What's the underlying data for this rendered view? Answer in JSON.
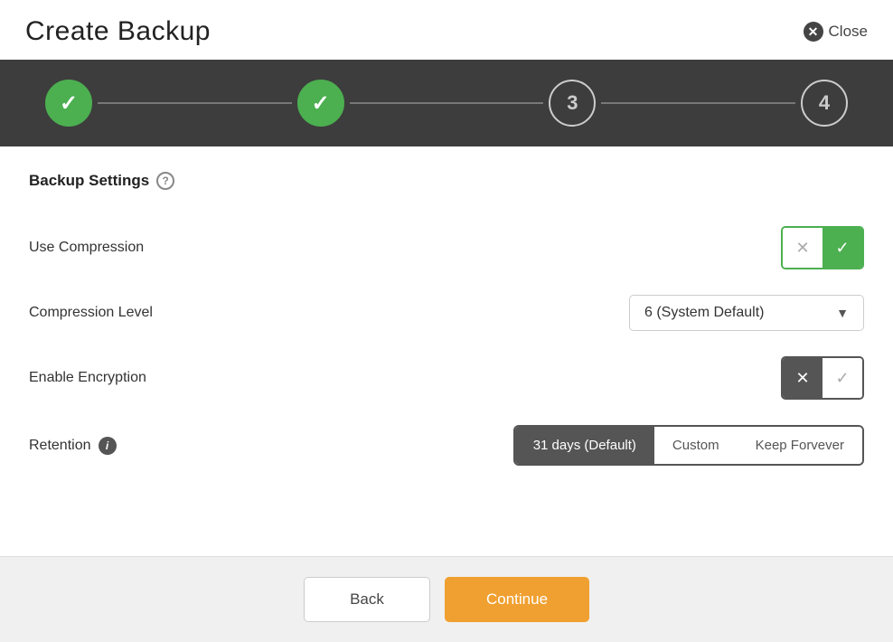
{
  "header": {
    "title": "Create Backup",
    "close_label": "Close"
  },
  "stepper": {
    "steps": [
      {
        "id": 1,
        "label": "✓",
        "state": "completed"
      },
      {
        "id": 2,
        "label": "✓",
        "state": "completed"
      },
      {
        "id": 3,
        "label": "3",
        "state": "active"
      },
      {
        "id": 4,
        "label": "4",
        "state": "inactive"
      }
    ]
  },
  "section": {
    "title": "Backup Settings",
    "help_icon": "?"
  },
  "settings": {
    "use_compression_label": "Use Compression",
    "compression_level_label": "Compression Level",
    "compression_level_value": "6 (System Default)",
    "enable_encryption_label": "Enable Encryption",
    "retention_label": "Retention"
  },
  "retention_options": [
    {
      "id": "default",
      "label": "31 days (Default)",
      "active": true
    },
    {
      "id": "custom",
      "label": "Custom",
      "active": false
    },
    {
      "id": "forever",
      "label": "Keep Forvever",
      "active": false
    }
  ],
  "footer": {
    "back_label": "Back",
    "continue_label": "Continue"
  },
  "icons": {
    "close": "✕",
    "check": "✓",
    "x": "✕",
    "arrow_down": "▼",
    "info": "i",
    "help": "?"
  }
}
